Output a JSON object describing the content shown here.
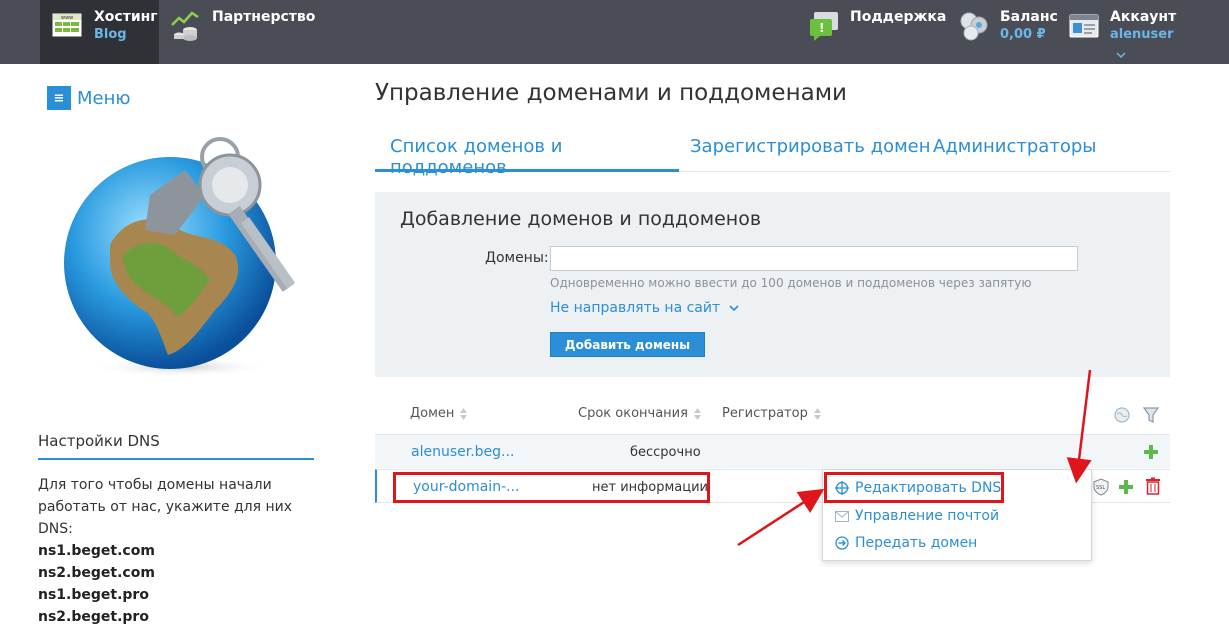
{
  "topbar": {
    "hosting": {
      "title": "Хостинг",
      "sub": "Blog"
    },
    "partner": {
      "title": "Партнерство"
    },
    "support": {
      "title": "Поддержка"
    },
    "balance": {
      "title": "Баланс",
      "sub": "0,00 ₽"
    },
    "account": {
      "title": "Аккаунт",
      "sub": "alenuser"
    }
  },
  "sidebar": {
    "menu_label": "Меню",
    "dns_title": "Настройки DNS",
    "dns_text": "Для того чтобы домены начали работать от нас, укажите для них DNS:",
    "ns": [
      "ns1.beget.com",
      "ns2.beget.com",
      "ns1.beget.pro",
      "ns2.beget.pro"
    ]
  },
  "main": {
    "page_title": "Управление доменами и поддоменами",
    "tabs": [
      {
        "label": "Список доменов и поддоменов"
      },
      {
        "label": "Зарегистрировать домен"
      },
      {
        "label": "Администраторы"
      }
    ],
    "add": {
      "title": "Добавление доменов и поддоменов",
      "domains_label": "Домены:",
      "hint": "Одновременно можно ввести до 100 доменов и поддоменов через запятую",
      "redirect_link": "Не направлять на сайт",
      "button": "Добавить домены"
    },
    "table": {
      "headers": {
        "domain": "Домен",
        "expires": "Срок окончания",
        "registrar": "Регистратор"
      },
      "rows": [
        {
          "domain": "alenuser.beg...",
          "expires": "бессрочно"
        },
        {
          "domain": "your-domain-...",
          "expires": "нет информации"
        }
      ]
    },
    "dropdown": {
      "items": [
        {
          "label": "Редактировать DNS"
        },
        {
          "label": "Управление почтой"
        },
        {
          "label": "Передать домен"
        }
      ]
    }
  },
  "colors": {
    "accent": "#2a8fd6",
    "topbar": "#4a4d55",
    "highlight": "#e0141b",
    "add_green": "#5db94a"
  }
}
